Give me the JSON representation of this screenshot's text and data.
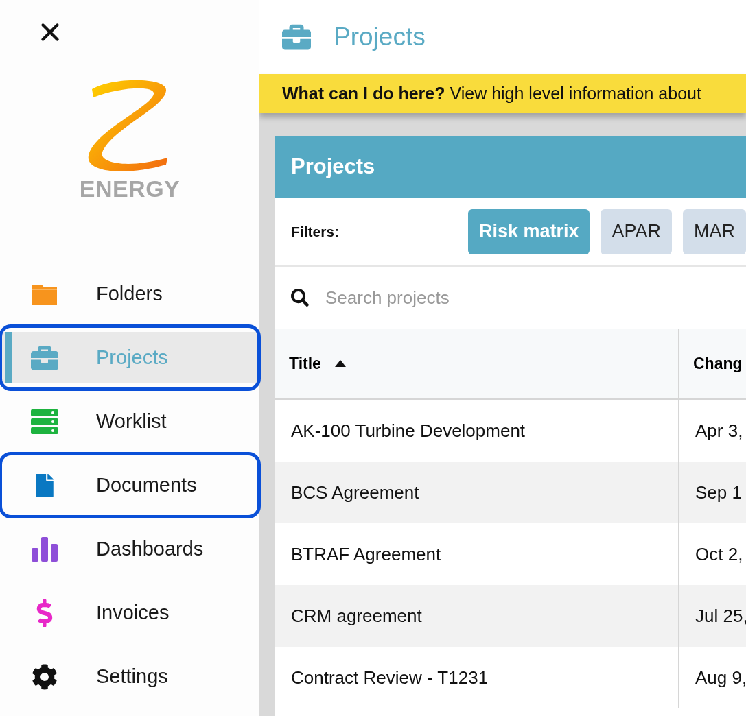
{
  "logo": {
    "text": "ENERGY"
  },
  "sidebar": {
    "items": [
      {
        "kind": "folders",
        "label": "Folders",
        "selected": false,
        "highlighted": false
      },
      {
        "kind": "projects",
        "label": "Projects",
        "selected": true,
        "highlighted": true
      },
      {
        "kind": "worklist",
        "label": "Worklist",
        "selected": false,
        "highlighted": false
      },
      {
        "kind": "documents",
        "label": "Documents",
        "selected": false,
        "highlighted": true
      },
      {
        "kind": "dashboards",
        "label": "Dashboards",
        "selected": false,
        "highlighted": false
      },
      {
        "kind": "invoices",
        "label": "Invoices",
        "selected": false,
        "highlighted": false
      },
      {
        "kind": "settings",
        "label": "Settings",
        "selected": false,
        "highlighted": false
      }
    ]
  },
  "header": {
    "title": "Projects"
  },
  "banner": {
    "text": "**What can I do here?** View high level information about"
  },
  "card": {
    "title": "Projects",
    "filters": {
      "label": "Filters:",
      "chips": [
        {
          "label": "Risk matrix",
          "selected": true
        },
        {
          "label": "APAR",
          "selected": false
        },
        {
          "label": "MAR",
          "selected": false
        }
      ]
    },
    "search": {
      "placeholder": "Search projects"
    },
    "table": {
      "columns": [
        {
          "label": "Title",
          "sorted": true
        },
        {
          "label": "Chang"
        }
      ],
      "rows": [
        [
          "AK-100 Turbine Development",
          "Apr 3,"
        ],
        [
          "BCS Agreement",
          "Sep 1"
        ],
        [
          "BTRAF Agreement",
          "Oct 2,"
        ],
        [
          "CRM agreement",
          "Jul 25,"
        ],
        [
          "Contract Review - T1231",
          "Aug 9,"
        ]
      ]
    }
  }
}
